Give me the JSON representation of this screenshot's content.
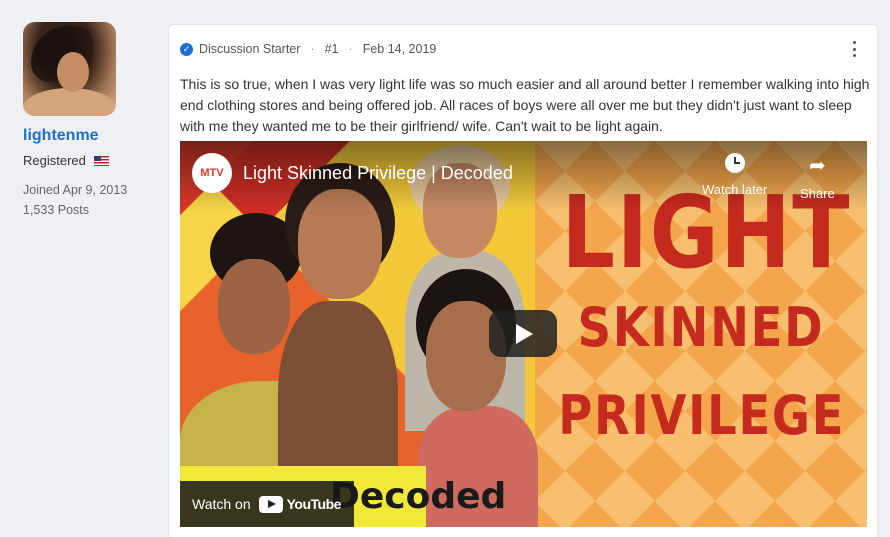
{
  "user": {
    "username": "lightenme",
    "role": "Registered",
    "joined": "Joined Apr 9, 2013",
    "posts": "1,533 Posts"
  },
  "post": {
    "badge": "Discussion Starter",
    "number": "#1",
    "date": "Feb 14, 2019",
    "text": "This is so true, when I was very light life was so much easier and all around better I remember walking into high end clothing stores and being offered job. All races of boys were all over me but they didn't just want to sleep with me they wanted me to be their girlfriend/ wife. Can't wait to be light again."
  },
  "video": {
    "channel_badge": "MTV",
    "title": "Light Skinned Privilege | Decoded",
    "watch_later": "Watch later",
    "share": "Share",
    "thumb_words": [
      "LIGHT",
      "SKINNED",
      "PRIVILEGE"
    ],
    "watch_on": "Watch on",
    "youtube": "YouTube",
    "decoded": "Decoded"
  },
  "colors": {
    "username": "#1f6fd0",
    "thumb_red": "#c42a1e",
    "background": "#eef0f3"
  }
}
